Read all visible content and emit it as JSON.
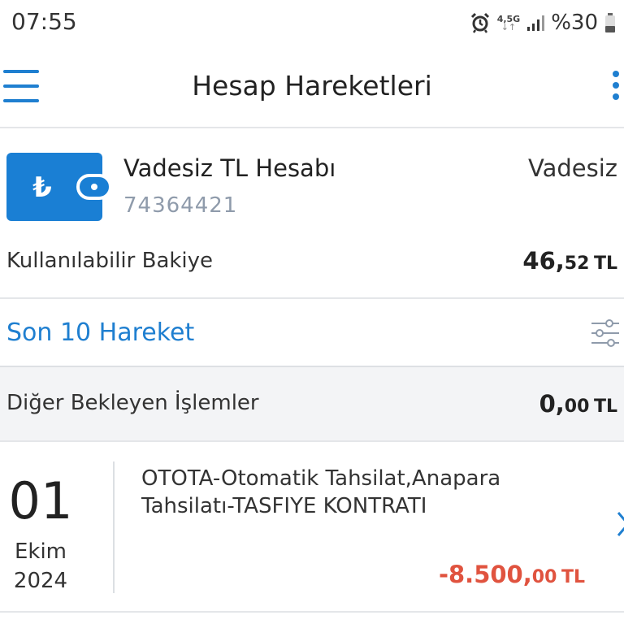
{
  "status_bar": {
    "time": "07:55",
    "network_type": "4,5G",
    "battery": "%30",
    "icons": [
      "alarm-icon",
      "signal-icon",
      "battery-icon"
    ]
  },
  "header": {
    "title": "Hesap Hareketleri",
    "menu_icon": "hamburger-menu-icon",
    "more_icon": "more-vertical-icon"
  },
  "account": {
    "name": "Vadesiz TL Hesabı",
    "number": "74364421",
    "type": "Vadesiz",
    "currency_symbol": "₺",
    "balance_label": "Kullanılabilir Bakiye",
    "balance_int": "46,",
    "balance_dec": "52",
    "balance_unit": "TL"
  },
  "moves": {
    "title": "Son 10 Hareket",
    "filter_icon": "filter-sliders-icon"
  },
  "pending": {
    "label": "Diğer Bekleyen İşlemler",
    "amount_int": "0,",
    "amount_dec": "00",
    "amount_unit": "TL"
  },
  "transactions": [
    {
      "day": "01",
      "month": "Ekim",
      "year": "2024",
      "description": "OTOTA-Otomatik Tahsilat,Anapara Tahsilatı-TASFIYE KONTRATI",
      "amount_int": "-8.500,",
      "amount_dec": "00",
      "amount_unit": "TL"
    }
  ],
  "colors": {
    "accent": "#1f7fd0",
    "wallet": "#1a7fd4",
    "negative": "#e0533f",
    "secondary_text": "#8f9bab"
  }
}
